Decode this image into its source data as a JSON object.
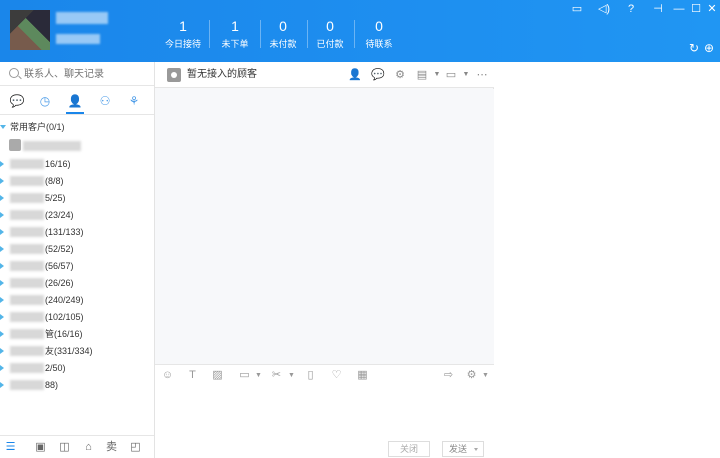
{
  "header": {
    "stats": [
      {
        "value": "1",
        "label": "今日接待"
      },
      {
        "value": "1",
        "label": "未下单"
      },
      {
        "value": "0",
        "label": "未付款"
      },
      {
        "value": "0",
        "label": "已付款"
      },
      {
        "value": "0",
        "label": "待联系"
      }
    ],
    "window_controls": [
      "message-icon",
      "volume-icon",
      "help-icon",
      "pin-icon",
      "minimize-icon",
      "maximize-icon",
      "close-icon"
    ],
    "accent": "#1a86ea"
  },
  "search": {
    "placeholder": "联系人、聊天记录"
  },
  "contacts": {
    "common_group": "常用客户(0/1)",
    "groups": [
      {
        "count": "16/16)"
      },
      {
        "count": "(8/8)"
      },
      {
        "count": "5/25)"
      },
      {
        "count": "(23/24)"
      },
      {
        "count": "(131/133)"
      },
      {
        "count": "(52/52)"
      },
      {
        "count": "(56/57)"
      },
      {
        "count": "(26/26)"
      },
      {
        "count": "(240/249)"
      },
      {
        "count": "(102/105)"
      },
      {
        "count": "管(16/16)"
      },
      {
        "count": "友(331/334)"
      },
      {
        "count": "2/50)"
      },
      {
        "count": "88)"
      }
    ]
  },
  "bottom_bar": {
    "sell_label": "卖"
  },
  "chat": {
    "title": "暂无接入的顾客",
    "close_label": "关闭",
    "send_label": "发送"
  }
}
